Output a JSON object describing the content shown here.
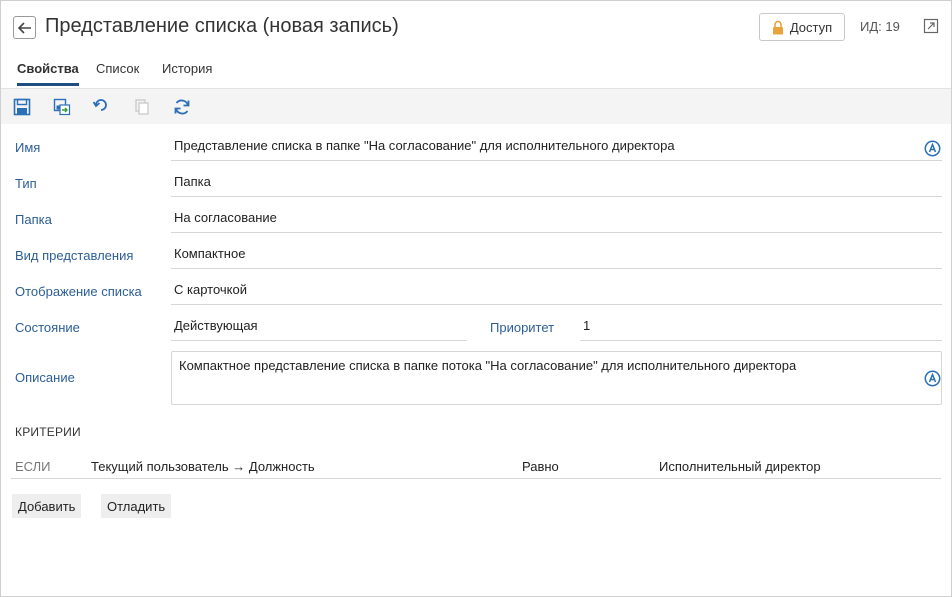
{
  "header": {
    "title": "Представление списка (новая запись)",
    "access_label": "Доступ",
    "record_id": "ИД: 19"
  },
  "tabs": [
    {
      "label": "Свойства",
      "active": true
    },
    {
      "label": "Список",
      "active": false
    },
    {
      "label": "История",
      "active": false
    }
  ],
  "toolbar": {
    "icons": [
      "save-icon",
      "save-and-close-icon",
      "undo-icon",
      "copy-icon",
      "refresh-icon"
    ]
  },
  "form": {
    "name": {
      "label": "Имя",
      "value": "Представление списка в папке \"На согласование\" для исполнительного директора"
    },
    "type": {
      "label": "Тип",
      "value": "Папка"
    },
    "folder": {
      "label": "Папка",
      "value": "На согласование"
    },
    "view_type": {
      "label": "Вид представления",
      "value": "Компактное"
    },
    "list_display": {
      "label": "Отображение списка",
      "value": "С карточкой"
    },
    "state": {
      "label": "Состояние",
      "value": "Действующая"
    },
    "priority": {
      "label": "Приоритет",
      "value": "1"
    },
    "description": {
      "label": "Описание",
      "value": "Компактное представление списка в папке потока \"На согласование\" для исполнительного директора"
    }
  },
  "criteria": {
    "title": "КРИТЕРИИ",
    "rows": [
      {
        "condition": "ЕСЛИ",
        "field": "Текущий пользователь → Должность",
        "operator": "Равно",
        "value": "Исполнительный директор"
      }
    ]
  },
  "actions": {
    "add_label": "Добавить",
    "debug_label": "Отладить"
  },
  "colors": {
    "label": "#2b5e96",
    "accent": "#1e4f80",
    "toolbar_icon": "#2a6fb8",
    "lock": "#e8a33a"
  }
}
